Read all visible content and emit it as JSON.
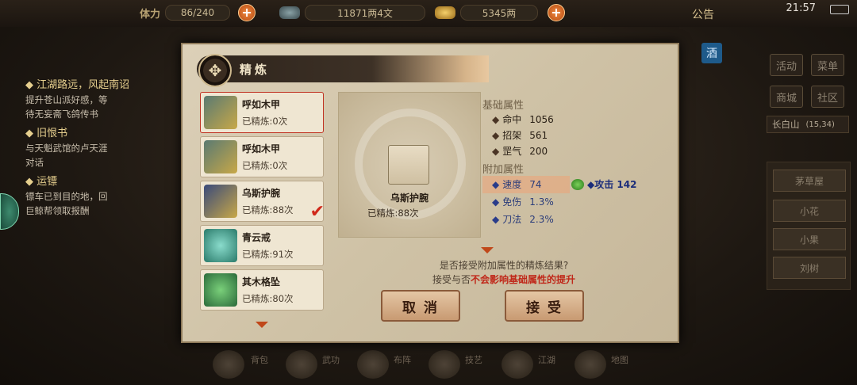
{
  "topbar": {
    "stamina_label": "体力",
    "stamina_value": "86/240",
    "silver_value": "11871两4文",
    "gold_value": "5345两",
    "notice": "公告",
    "clock": "21:57"
  },
  "quests": [
    {
      "title": "江湖路远，风起南诏",
      "desc": [
        "提升苍山派好感，等",
        "待无妄斋飞鸽传书"
      ]
    },
    {
      "title": "旧恨书",
      "desc": [
        "与天魁武馆的卢天涯",
        "对话"
      ]
    },
    {
      "title": "运镖",
      "desc": [
        "镖车已到目的地，回",
        "巨鲸帮领取报酬"
      ]
    }
  ],
  "right_menu": {
    "wine": "酒",
    "buttons": [
      "活动",
      "菜单",
      "商城",
      "社区"
    ],
    "location": "长白山",
    "coords": "(15,34)",
    "npcs": [
      "茅草屋",
      "小花",
      "小果",
      "刘树"
    ]
  },
  "bottom_bar": [
    "背包",
    "武功",
    "布阵",
    "技艺",
    "江湖",
    "地图"
  ],
  "dialog": {
    "title": "精炼",
    "items": [
      {
        "name": "呼如木甲",
        "count": "已精炼:0次",
        "selected": false
      },
      {
        "name": "呼如木甲",
        "count": "已精炼:0次",
        "selected": false
      },
      {
        "name": "乌斯护腕",
        "count": "已精炼:88次",
        "selected": true
      },
      {
        "name": "青云戒",
        "count": "已精炼:91次",
        "selected": false
      },
      {
        "name": "其木格坠",
        "count": "已精炼:80次",
        "selected": false
      }
    ],
    "preview": {
      "name": "乌斯护腕",
      "count": "已精炼:88次"
    },
    "base_title": "基础属性",
    "base": [
      {
        "name": "命中",
        "value": "1056"
      },
      {
        "name": "招架",
        "value": "561"
      },
      {
        "name": "罡气",
        "value": "200"
      }
    ],
    "extra_title": "附加属性",
    "extra": [
      {
        "name": "速度",
        "value": "74"
      },
      {
        "name": "免伤",
        "value": "1.3%"
      },
      {
        "name": "刀法",
        "value": "2.3%"
      }
    ],
    "new_attr": "◆攻击  142",
    "confirm_q": "是否接受附加属性的精炼结果?",
    "confirm_note_pre": "接受与否",
    "confirm_note_red": "不会影响基础属性的提升",
    "cancel": "取消",
    "accept": "接受"
  },
  "colors": {
    "accent_red": "#c0281a",
    "new_attr_blue": "#1a2c7a"
  }
}
